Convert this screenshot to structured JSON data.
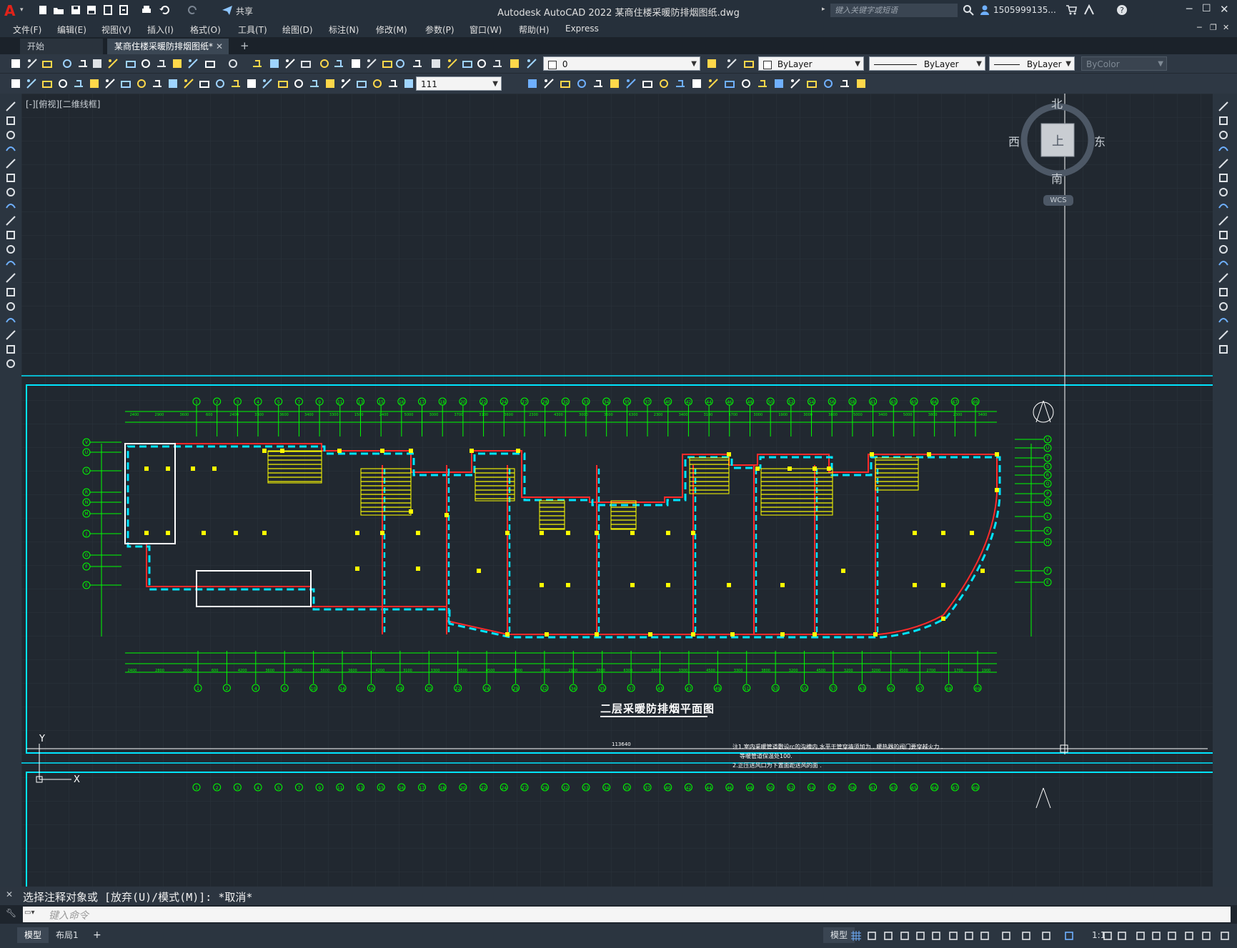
{
  "app": {
    "title": "Autodesk AutoCAD 2022    某商住楼采暖防排烟图纸.dwg",
    "logo_letter": "A",
    "share_label": "共享",
    "search_placeholder": "键入关键字或短语",
    "user": "1505999135...",
    "help": "?"
  },
  "menu": [
    "文件(F)",
    "编辑(E)",
    "视图(V)",
    "插入(I)",
    "格式(O)",
    "工具(T)",
    "绘图(D)",
    "标注(N)",
    "修改(M)",
    "参数(P)",
    "窗口(W)",
    "帮助(H)",
    "Express"
  ],
  "tabs": {
    "start": "开始",
    "document": "某商住楼采暖防排烟图纸*",
    "close": "✕",
    "add": "+"
  },
  "toolbar": {
    "layer_name": "0",
    "color": "ByLayer",
    "linetype": "ByLayer",
    "lineweight": "ByLayer",
    "plotstyle": "ByColor",
    "dimscale": "111"
  },
  "viewport": {
    "label": "[-][俯视][二维线框]",
    "compass": {
      "north": "北",
      "south": "南",
      "east": "东",
      "west": "西",
      "top": "上",
      "wcs": "WCS"
    }
  },
  "drawing": {
    "title": "二层采暖防排烟平面图",
    "notes": [
      "注1.室内采暖管道敷设rc的沟槽内,水平干管穿墙须加为  .  暖热器的阀门要穿越火力  .",
      "等暖管道保温处100.",
      "2.正压送风口为下置面距送风的面  ."
    ],
    "total_dim": "113640",
    "top_axes": [
      "1",
      "2",
      "3",
      "4",
      "5",
      "7",
      "9",
      "11",
      "13",
      "15",
      "16",
      "17",
      "18",
      "20",
      "22",
      "24",
      "27",
      "28",
      "32",
      "33",
      "34",
      "35",
      "37",
      "40",
      "42",
      "44",
      "46",
      "48",
      "50",
      "52",
      "54",
      "56",
      "58",
      "61",
      "63",
      "65",
      "66",
      "67",
      "69"
    ],
    "bottom_axes": [
      "1",
      "2",
      "4",
      "6",
      "10",
      "14",
      "16",
      "18",
      "20",
      "22",
      "24",
      "29",
      "32",
      "34",
      "35",
      "37",
      "43",
      "47",
      "49",
      "51",
      "53",
      "55",
      "57",
      "63",
      "65",
      "67",
      "68",
      "69"
    ],
    "left_axes": [
      "V",
      "U",
      "S",
      "R",
      "N",
      "M",
      "J",
      "G",
      "F",
      "E"
    ],
    "right_axes": [
      "V",
      "U",
      "T",
      "S",
      "R",
      "Q",
      "P",
      "N",
      "L",
      "K",
      "H",
      "F",
      "E"
    ],
    "top_dims": [
      "2400",
      "2900",
      "3600",
      "600",
      "2400",
      "3300",
      "3600",
      "3400",
      "3300",
      "1500",
      "2400",
      "5000",
      "3000",
      "3700",
      "3100",
      "3600",
      "2300",
      "4300",
      "3000",
      "3600",
      "6300",
      "2300",
      "3400",
      "3100",
      "5700",
      "3000",
      "1900",
      "3000",
      "3800",
      "5000",
      "3400",
      "5000",
      "3800",
      "2300",
      "3400"
    ],
    "bottom_dims": [
      "2400",
      "2800",
      "3600",
      "600",
      "4200",
      "3600",
      "5600",
      "5600",
      "3600",
      "4200",
      "3100",
      "3300",
      "4500",
      "4500",
      "3800",
      "3300",
      "2900",
      "3300",
      "6300",
      "3300",
      "3300",
      "4500",
      "3300",
      "3800",
      "3200",
      "4500",
      "3200",
      "3200",
      "4500",
      "2700",
      "1700",
      "1900"
    ]
  },
  "command": {
    "history": "选择注释对象或 [放弃(U)/模式(M)]: *取消*",
    "placeholder": "键入命令"
  },
  "status": {
    "model_tab": "模型",
    "layout_tab": "布局1",
    "add": "+",
    "model_btn": "模型",
    "scale": "1:1"
  },
  "colors": {
    "axis": "#00ff00",
    "wall": "#ff2a2a",
    "duct": "#00e5ff",
    "stair": "#ffff00",
    "frame": "#00e5ff"
  }
}
